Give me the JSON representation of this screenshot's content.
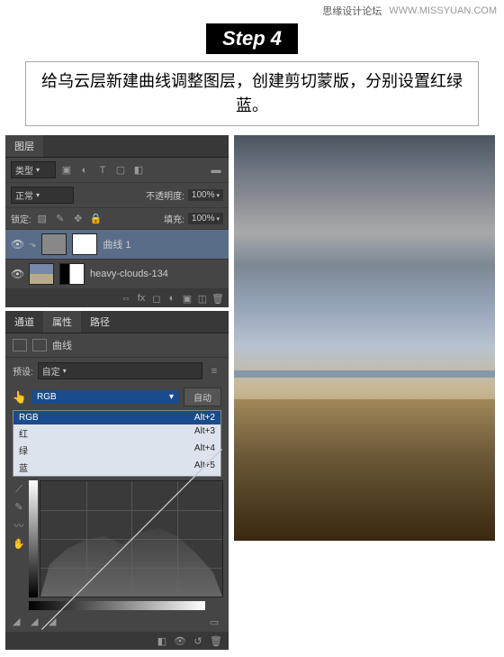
{
  "topbar": {
    "site": "思缘设计论坛",
    "url": "WWW.MISSYUAN.COM"
  },
  "step_badge": "Step 4",
  "instruction": "给乌云层新建曲线调整图层，创建剪切蒙版，分别设置红绿蓝。",
  "layers_panel": {
    "tab": "图层",
    "filter_label": "类型",
    "blend_mode": "正常",
    "opacity_label": "不透明度:",
    "opacity_value": "100%",
    "lock_label": "锁定:",
    "fill_label": "填充:",
    "fill_value": "100%",
    "layers": [
      {
        "name": "曲线 1",
        "clipped": true
      },
      {
        "name": "heavy-clouds-134",
        "clipped": false
      }
    ]
  },
  "props_panel": {
    "tabs": [
      "通道",
      "属性",
      "路径"
    ],
    "title": "曲线",
    "preset_label": "预设:",
    "preset_value": "自定",
    "channel_value": "RGB",
    "auto_label": "自动",
    "dropdown": [
      {
        "name": "RGB",
        "key": "Alt+2"
      },
      {
        "name": "红",
        "key": "Alt+3"
      },
      {
        "name": "绿",
        "key": "Alt+4"
      },
      {
        "name": "蓝",
        "key": "Alt+5"
      }
    ]
  }
}
